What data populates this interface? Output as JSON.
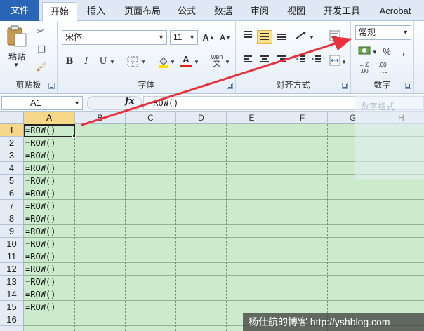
{
  "ribbon_tabs": [
    "文件",
    "开始",
    "插入",
    "页面布局",
    "公式",
    "数据",
    "审阅",
    "视图",
    "开发工具",
    "Acrobat"
  ],
  "active_tab": "开始",
  "clipboard": {
    "paste_label": "粘贴",
    "group_label": "剪贴板"
  },
  "font": {
    "name": "宋体",
    "size": "11",
    "bold": "B",
    "italic": "I",
    "underline": "U",
    "phonetic": "wén",
    "group_label": "字体"
  },
  "alignment": {
    "group_label": "对齐方式"
  },
  "number": {
    "format": "常规",
    "percent": "%",
    "comma": ",",
    "group_label": "数字"
  },
  "formula_bar": {
    "name_box": "A1",
    "fx": "fx",
    "content": "=ROW()"
  },
  "columns": [
    "A",
    "B",
    "C",
    "D",
    "E",
    "F",
    "G",
    "H"
  ],
  "rows": [
    "1",
    "2",
    "3",
    "4",
    "5",
    "6",
    "7",
    "8",
    "9",
    "10",
    "11",
    "12",
    "13",
    "14",
    "15",
    "16"
  ],
  "cells": [
    "=ROW()",
    "=ROW()",
    "=ROW()",
    "=ROW()",
    "=ROW()",
    "=ROW()",
    "=ROW()",
    "=ROW()",
    "=ROW()",
    "=ROW()",
    "=ROW()",
    "=ROW()",
    "=ROW()",
    "=ROW()",
    "=ROW()"
  ],
  "style_pane": {
    "title": "数字格式"
  },
  "watermark": "杨仕航的博客 http://yshblog.com",
  "colors": {
    "file_tab": "#2a66b8",
    "cell_bg": "#ccebcc",
    "selected_header": "#f6d888",
    "arrow": "#e8323c"
  }
}
